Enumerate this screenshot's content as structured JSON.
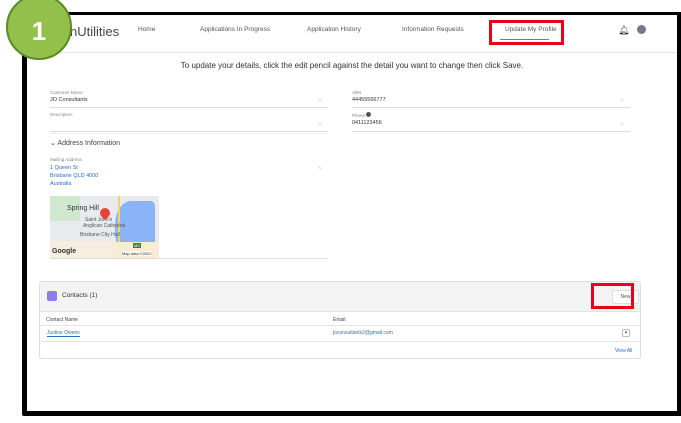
{
  "step_badge": "1",
  "header": {
    "logo_text": "nUtilities",
    "nav": [
      {
        "label": "Home"
      },
      {
        "label": "Applications In Progress"
      },
      {
        "label": "Application History"
      },
      {
        "label": "Information Requests"
      },
      {
        "label": "Update My Profile",
        "active": true
      }
    ]
  },
  "instruction": "To update your details, click the edit pencil against the detail you want to change then click Save.",
  "fields": {
    "customer_name": {
      "label": "Customer Name",
      "value": "JO Consultants"
    },
    "abn": {
      "label": "ABN",
      "value": "44455566777"
    },
    "description": {
      "label": "Description",
      "value": ""
    },
    "phone": {
      "label": "Phone",
      "value": "0411123456"
    }
  },
  "address": {
    "section_title": "Address Information",
    "label": "Mailing Address",
    "line1": "1 Queen St",
    "line2": "Brisbane QLD 4000",
    "line3": "Australia",
    "map": {
      "label_spring_hill": "Spring Hill",
      "label_cathedral1": "Saint John's",
      "label_cathedral2": "Anglican Cathedral",
      "label_city_hall": "Brisbane City Hall",
      "google": "Google",
      "map_data": "Map data ©2022",
      "road": "M3"
    }
  },
  "contacts": {
    "title": "Contacts (1)",
    "new_label": "New",
    "columns": [
      "Contact Name",
      "Email"
    ],
    "rows": [
      {
        "name": "Justine Owens",
        "email": "joconsultants2@gmail.com"
      }
    ],
    "view_all": "View All"
  },
  "colors": {
    "highlight": "#e8001c",
    "badge": "#92c04a",
    "link": "#2a6ebb"
  }
}
